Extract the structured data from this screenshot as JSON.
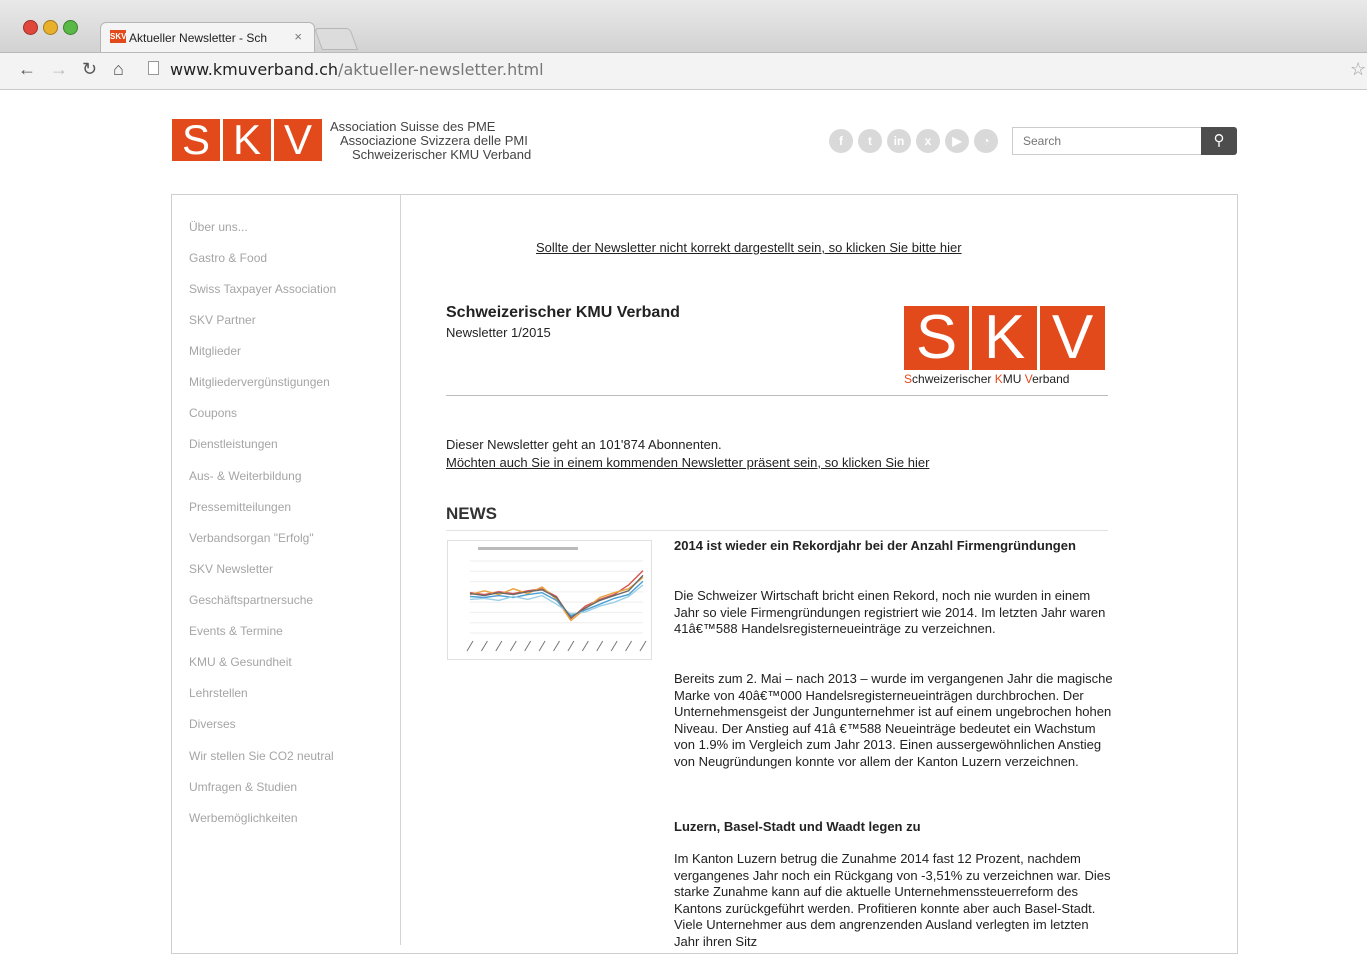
{
  "browser": {
    "tab_title": "Aktueller Newsletter - Sch",
    "tab_favicon": "SKV",
    "tab_close": "×",
    "url_domain": "www.kmuverband.ch",
    "url_path": "/aktueller-newsletter.html",
    "icons": [
      "back-icon",
      "forward-icon",
      "reload-icon",
      "home-icon",
      "page-icon",
      "star-icon"
    ]
  },
  "header": {
    "logo_letters": [
      "S",
      "K",
      "V"
    ],
    "tagline": [
      "Association Suisse des PME",
      "Associazione Svizzera delle PMI",
      "Schweizerischer KMU Verband"
    ],
    "social_icons": [
      "facebook-icon",
      "twitter-icon",
      "linkedin-icon",
      "xing-icon",
      "youtube-icon",
      "rss-icon"
    ],
    "search_placeholder": "Search"
  },
  "sidebar": {
    "items": [
      "Über uns...",
      "Gastro & Food",
      "Swiss Taxpayer Association",
      "SKV Partner",
      "Mitglieder",
      "Mitgliedervergünstigungen",
      "Coupons",
      "Dienstleistungen",
      "Aus- & Weiterbildung",
      "Pressemitteilungen",
      "Verbandsorgan \"Erfolg\"",
      "SKV Newsletter",
      "Geschäftspartnersuche",
      "Events & Termine",
      "KMU & Gesundheit",
      "Lehrstellen",
      "Diverses",
      "Wir stellen Sie CO2 neutral",
      "Umfragen & Studien",
      "Werbemöglichkeiten"
    ]
  },
  "content": {
    "top_link": "Sollte der Newsletter nicht korrekt dargestellt sein, so klicken Sie bitte hier",
    "newsletter_title": "Schweizerischer KMU Verband",
    "newsletter_issue": "Newsletter 1/2015",
    "logo_letters": [
      "S",
      "K",
      "V"
    ],
    "logo_sub": {
      "s": "S",
      "s_rest": "chweizerischer ",
      "k": "K",
      "k_rest": "MU ",
      "v": "V",
      "v_rest": "erband"
    },
    "subscribers_text": "Dieser Newsletter geht an 101'874 Abonnenten.",
    "subscribe_link": "Möchten auch Sie in einem kommenden Newsletter präsent sein, so klicken Sie hier",
    "news_heading": "NEWS",
    "article": {
      "title": "2014 ist wieder ein Rekordjahr bei der Anzahl Firmengründungen",
      "p1": "Die Schweizer Wirtschaft bricht einen Rekord, noch nie wurden in einem Jahr so viele Firmengründungen registriert wie 2014. Im letzten Jahr waren 41â€™588 Handelsregisterneueinträge zu verzeichnen.",
      "p2": "Bereits zum 2. Mai – nach 2013 – wurde im vergangenen Jahr die magische Marke von 40â€™000 Handelsregisterneueinträgen durchbrochen. Der Unternehmensgeist der Jungunternehmer ist auf einem ungebrochen hohen Niveau. Der Anstieg auf 41â €™588 Neueinträge bedeutet ein Wachstum von 1.9% im Vergleich zum Jahr 2013. Einen aussergewöhnlichen Anstieg von Neugründungen konnte vor allem der Kanton Luzern verzeichnen.",
      "subheading": "Luzern, Basel-Stadt und Waadt legen zu",
      "p3": "Im Kanton Luzern betrug die Zunahme 2014 fast 12 Prozent, nachdem vergangenes Jahr noch ein Rückgang von -3,51% zu verzeichnen war. Dies starke Zunahme kann auf die aktuelle Unternehmenssteuerreform des Kantons zurückgeführt werden. Profitieren konnte aber auch Basel-Stadt. Viele Unternehmer aus dem angrenzenden Ausland verlegten im letzten Jahr ihren Sitz"
    },
    "thumbnail_chart": {
      "series": [
        {
          "color": "#d9534f",
          "values": [
            62,
            60,
            63,
            61,
            64,
            66,
            58,
            35,
            48,
            55,
            60,
            70,
            85
          ]
        },
        {
          "color": "#e8a23b",
          "values": [
            60,
            64,
            60,
            66,
            61,
            68,
            55,
            33,
            45,
            57,
            62,
            66,
            78
          ]
        },
        {
          "color": "#4a9fd4",
          "values": [
            58,
            57,
            59,
            57,
            60,
            62,
            54,
            38,
            44,
            50,
            56,
            60,
            74
          ]
        },
        {
          "color": "#9ccfe6",
          "values": [
            55,
            56,
            54,
            58,
            55,
            59,
            50,
            40,
            42,
            48,
            52,
            58,
            70
          ]
        },
        {
          "color": "#6a6a6a",
          "values": [
            61,
            59,
            62,
            60,
            63,
            65,
            57,
            36,
            46,
            54,
            59,
            64,
            80
          ]
        }
      ]
    }
  }
}
